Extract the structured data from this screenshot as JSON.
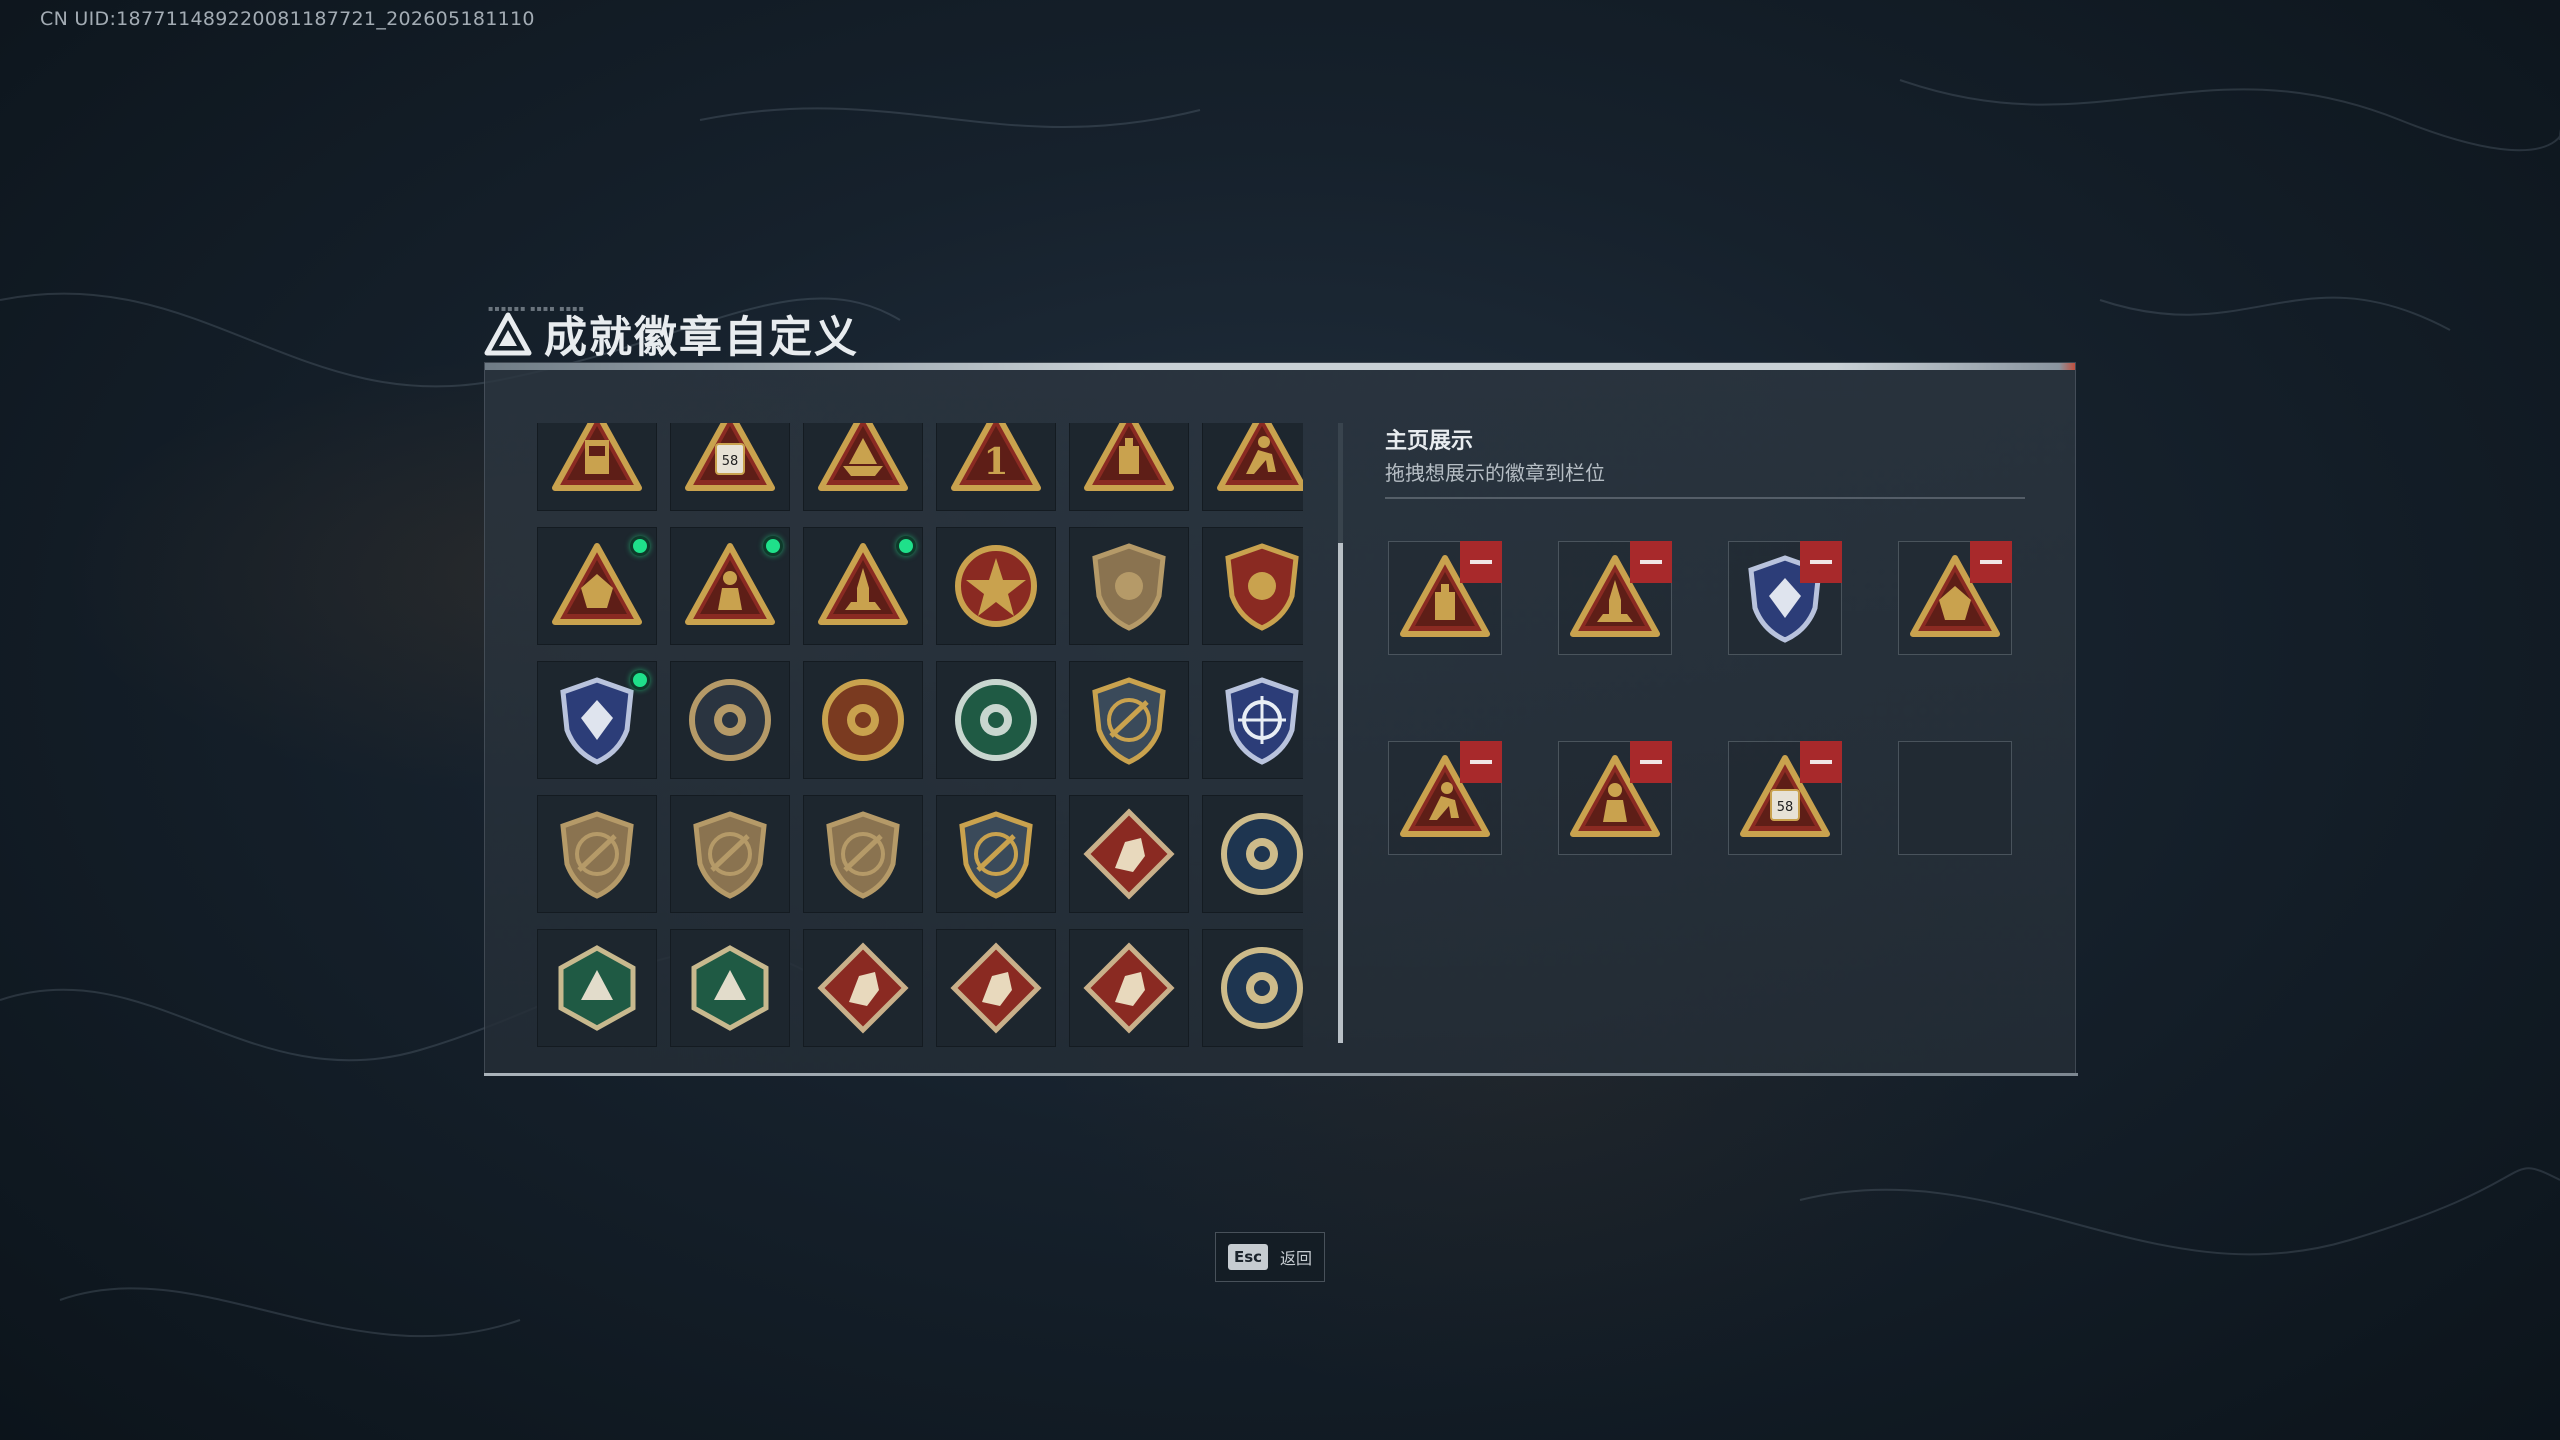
{
  "uid_text": "CN UID:18771148922008118772​1_202605181110",
  "title": "成就徽章自定义",
  "showcase": {
    "title": "主页展示",
    "subtitle": "拖拽想展示的徽章到栏位"
  },
  "badges": [
    {
      "icon": "gold-triangle-tower-badge",
      "new": false
    },
    {
      "icon": "gold-triangle-58-badge",
      "new": false
    },
    {
      "icon": "gold-triangle-boat-badge",
      "new": false
    },
    {
      "icon": "gold-triangle-number-1-badge",
      "new": false
    },
    {
      "icon": "gold-triangle-tank-badge",
      "new": false
    },
    {
      "icon": "gold-triangle-runner-badge",
      "new": false
    },
    {
      "icon": "gold-triangle-crest-badge",
      "new": true
    },
    {
      "icon": "gold-triangle-soldier-badge",
      "new": true
    },
    {
      "icon": "gold-triangle-rocket-badge",
      "new": true
    },
    {
      "icon": "red-star-round-badge",
      "new": false
    },
    {
      "icon": "bronze-shield-emblem-badge",
      "new": false
    },
    {
      "icon": "red-gold-shield-badge",
      "new": false
    },
    {
      "icon": "blue-shield-diamond-badge",
      "new": true
    },
    {
      "icon": "bronze-round-skull-badge",
      "new": false
    },
    {
      "icon": "gold-lion-round-badge",
      "new": false
    },
    {
      "icon": "green-gear-badge",
      "new": false
    },
    {
      "icon": "gold-crossed-rifles-shield-badge",
      "new": false
    },
    {
      "icon": "blue-crosshair-shield-badge",
      "new": false
    },
    {
      "icon": "bronze-rifle-shield-badge",
      "new": false
    },
    {
      "icon": "bronze-rifle-shield-badge",
      "new": false
    },
    {
      "icon": "bronze-rifle-shield-badge",
      "new": false
    },
    {
      "icon": "gold-rifles-shield-badge",
      "new": false
    },
    {
      "icon": "red-wolf-diamond-badge",
      "new": false
    },
    {
      "icon": "blue-eagle-round-badge",
      "new": false
    },
    {
      "icon": "green-wasp-hexagon-badge",
      "new": false
    },
    {
      "icon": "green-hammer-hexagon-badge",
      "new": false
    },
    {
      "icon": "red-dragon-diamond-badge",
      "new": false
    },
    {
      "icon": "red-dragon-diamond-badge",
      "new": false
    },
    {
      "icon": "red-runner-diamond-badge",
      "new": false
    },
    {
      "icon": "blue-wolf-round-badge",
      "new": false
    }
  ],
  "slots": [
    {
      "icon": "gold-triangle-tank-badge",
      "filled": true
    },
    {
      "icon": "gold-triangle-rocket-badge",
      "filled": true
    },
    {
      "icon": "blue-shield-diamond-badge",
      "filled": true
    },
    {
      "icon": "gold-triangle-crest-badge",
      "filled": true
    },
    {
      "icon": "gold-triangle-runner-badge",
      "filled": true
    },
    {
      "icon": "gold-triangle-soldier-badge",
      "filled": true
    },
    {
      "icon": "gold-triangle-58-badge",
      "filled": true
    },
    {
      "icon": "",
      "filled": false
    }
  ],
  "esc": {
    "key": "Esc",
    "label": "返回"
  },
  "colors": {
    "accent_new": "#1fe08a",
    "remove_red": "#a8292b",
    "gold": "#c9a24e",
    "bronze": "#8a7350",
    "red_badge": "#8a2a22",
    "blue_badge": "#2c3d78",
    "green_badge": "#1f5a44"
  }
}
